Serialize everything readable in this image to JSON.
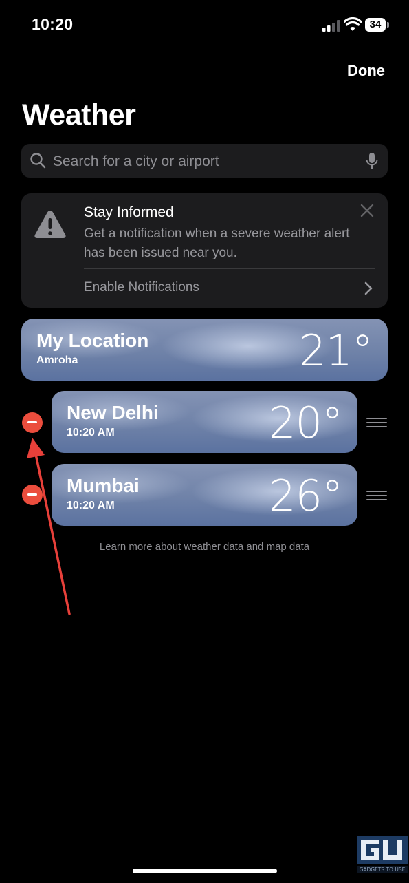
{
  "status": {
    "time": "10:20",
    "battery": "34"
  },
  "header": {
    "done_label": "Done",
    "title": "Weather"
  },
  "search": {
    "placeholder": "Search for a city or airport"
  },
  "alert": {
    "title": "Stay Informed",
    "body": "Get a notification when a severe weather alert has been issued near you.",
    "action": "Enable Notifications"
  },
  "locations": [
    {
      "name": "My Location",
      "subtitle": "Amroha",
      "temp": "21°"
    },
    {
      "name": "New Delhi",
      "subtitle": "10:20 AM",
      "temp": "20°"
    },
    {
      "name": "Mumbai",
      "subtitle": "10:20 AM",
      "temp": "26°"
    }
  ],
  "footer": {
    "prefix": "Learn more about",
    "link1": "weather data",
    "middle": "and",
    "link2": "map data"
  },
  "colors": {
    "background": "#000000",
    "delete_red": "#eb4d3d",
    "annotation_arrow": "#e8403a"
  },
  "watermark": "GADGETS TO USE"
}
